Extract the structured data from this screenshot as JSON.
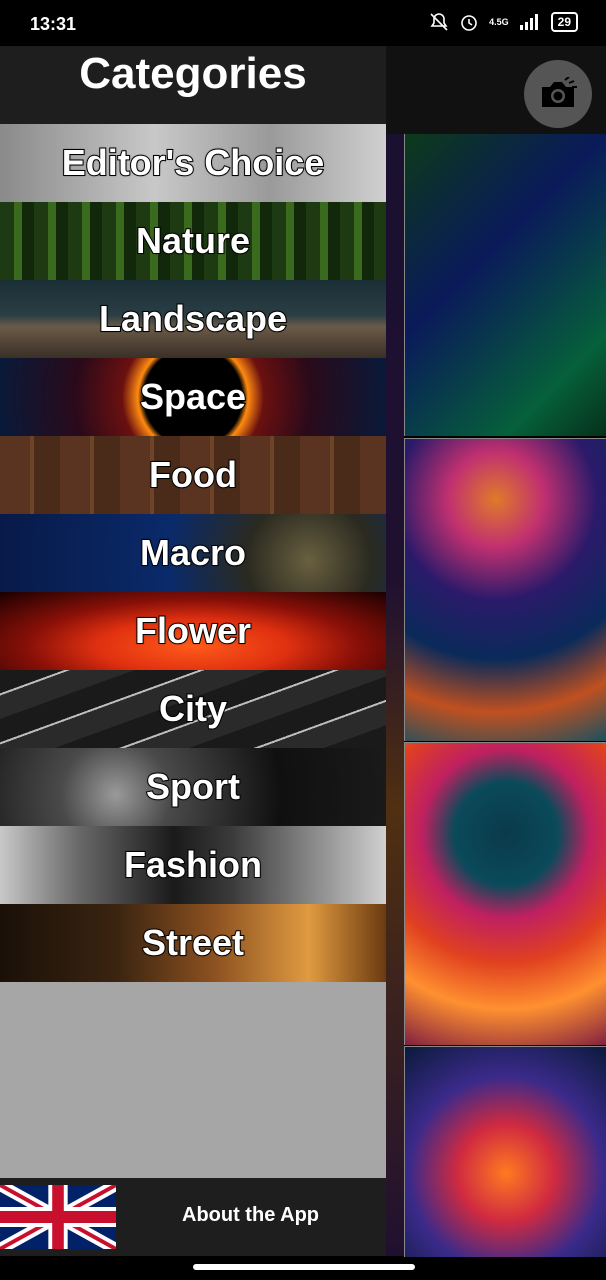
{
  "status": {
    "time": "13:31",
    "network": "4.5G",
    "battery": "29"
  },
  "drawer": {
    "title": "Categories",
    "categories": [
      {
        "label": "Editor's Choice"
      },
      {
        "label": "Nature"
      },
      {
        "label": "Landscape"
      },
      {
        "label": "Space"
      },
      {
        "label": "Food"
      },
      {
        "label": "Macro"
      },
      {
        "label": "Flower"
      },
      {
        "label": "City"
      },
      {
        "label": "Sport"
      },
      {
        "label": "Fashion"
      },
      {
        "label": "Street"
      }
    ],
    "footer": {
      "about_label": "About the App",
      "flag_icon": "uk-flag-icon"
    }
  },
  "main": {
    "camera_icon": "camera-icon"
  }
}
